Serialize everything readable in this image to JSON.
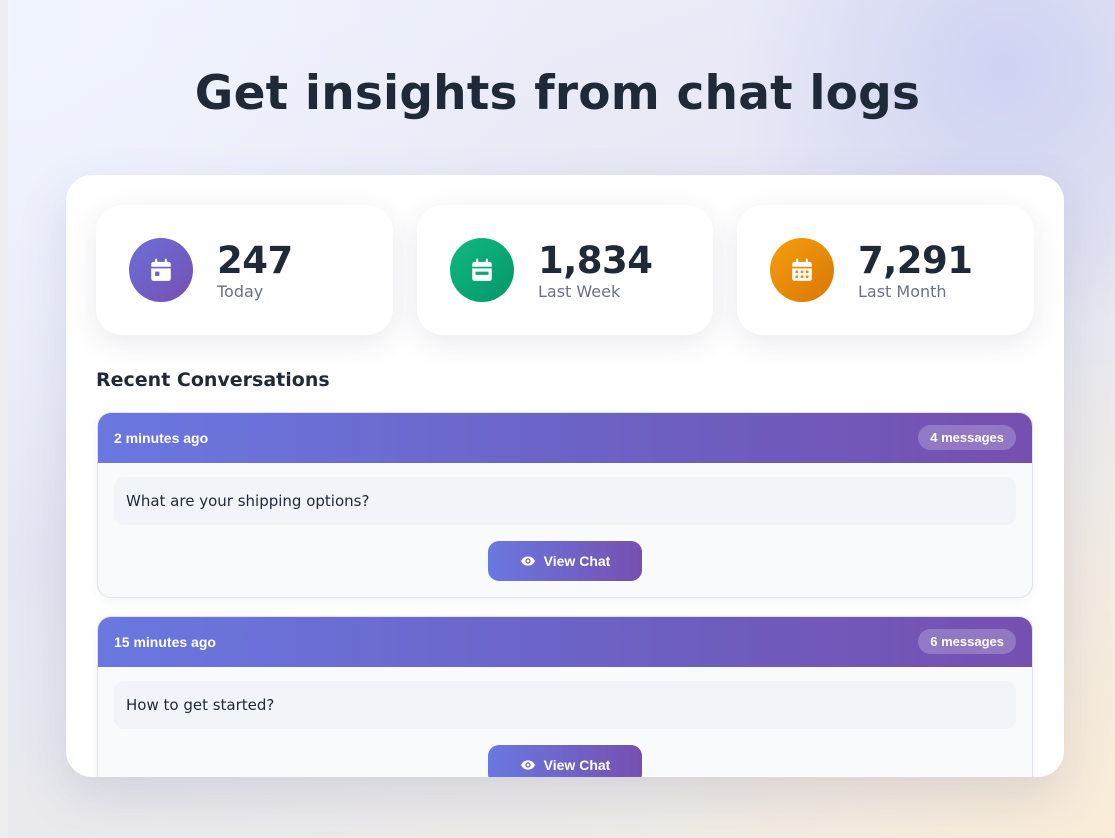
{
  "page": {
    "title": "Get insights from chat logs"
  },
  "stats": [
    {
      "value": "247",
      "label": "Today",
      "icon": "calendar-day-icon",
      "color": "#6a6fd8"
    },
    {
      "value": "1,834",
      "label": "Last Week",
      "icon": "calendar-week-icon",
      "color": "#10b981"
    },
    {
      "value": "7,291",
      "label": "Last Month",
      "icon": "calendar-month-icon",
      "color": "#f59e0b"
    }
  ],
  "recent": {
    "title": "Recent Conversations",
    "items": [
      {
        "time": "2 minutes ago",
        "count": "4 messages",
        "message": "What are your shipping options?",
        "button": "View Chat"
      },
      {
        "time": "15 minutes ago",
        "count": "6 messages",
        "message": "How to get started?",
        "button": "View Chat"
      }
    ]
  }
}
